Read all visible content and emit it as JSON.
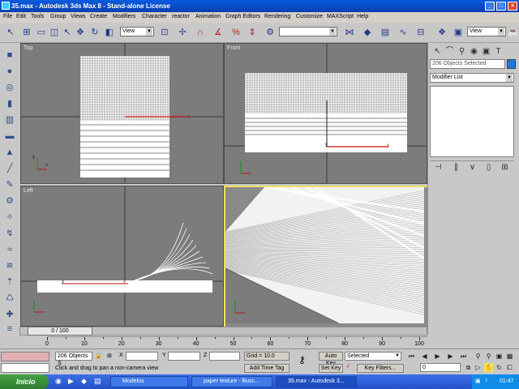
{
  "window": {
    "title": "35.max - Autodesk 3ds Max 8 - Stand-alone License",
    "minimize": "_",
    "maximize": "□",
    "close": "×"
  },
  "menu": [
    "File",
    "Edit",
    "Tools",
    "Group",
    "Views",
    "Create",
    "Modifiers",
    "Character",
    "reactor",
    "Animation",
    "Graph Editors",
    "Rendering",
    "Customize",
    "MAXScript",
    "Help"
  ],
  "toolbar": {
    "ref_coord": "View",
    "named_selection": "",
    "render_view": "View",
    "icons": [
      "undo-icon",
      "redo-icon",
      "link-icon",
      "unlink-icon",
      "bind-spacewarp-icon",
      "select-icon",
      "select-by-name-icon",
      "region-select-icon",
      "window-crossing-icon",
      "move-icon",
      "rotate-icon",
      "scale-icon",
      "pivot-icon",
      "manipulate-icon",
      "snap-3d-icon",
      "angle-snap-icon",
      "percent-snap-icon",
      "spinner-snap-icon",
      "mirror-icon",
      "align-icon",
      "layer-manager-icon",
      "curve-editor-icon",
      "schematic-icon",
      "material-editor-icon",
      "render-scene-icon",
      "quick-render-icon"
    ]
  },
  "viewports": {
    "top": "Top",
    "front": "Front",
    "left": "Left",
    "perspective": ""
  },
  "command_panel": {
    "selection_field": "206 Objects Selected",
    "modifier_list": "Modifier List",
    "swatch_color": "#1e7ad9"
  },
  "timeline": {
    "frame_counter": "0 / 100",
    "ticks": [
      "0",
      "10",
      "20",
      "30",
      "40",
      "50",
      "60",
      "70",
      "80",
      "90",
      "100"
    ]
  },
  "status": {
    "objects": "206 Objects S",
    "prompt": "Click and drag to pan a non-camera view",
    "x_label": "X",
    "y_label": "Y",
    "z_label": "Z",
    "x_value": "",
    "y_value": "",
    "z_value": "",
    "grid": "Grid = 10.0",
    "add_time_tag": "Add Time Tag",
    "auto_key": "Auto Key",
    "set_key": "Set Key",
    "key_mode": "Selected",
    "key_filters": "Key Filters...",
    "frame": "0"
  },
  "taskbar": {
    "start": "Inicio",
    "tasks": [
      "Modelos",
      "paper texture - Busc...",
      "35.max - Autodesk 3..."
    ],
    "clock": "01:47"
  }
}
